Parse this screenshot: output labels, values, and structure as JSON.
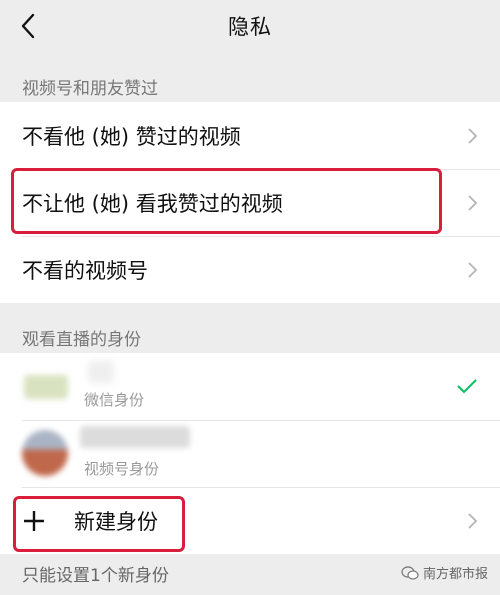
{
  "nav": {
    "title": "隐私",
    "back_icon": "chevron-left-icon"
  },
  "section1": {
    "label": "视频号和朋友赞过",
    "items": [
      {
        "label": "不看他 (她) 赞过的视频"
      },
      {
        "label": "不让他 (她) 看我赞过的视频",
        "highlighted": true
      },
      {
        "label": "不看的视频号"
      }
    ]
  },
  "section2": {
    "label": "观看直播的身份",
    "identities": [
      {
        "sublabel": "微信身份",
        "selected": true
      },
      {
        "sublabel": "视频号身份",
        "selected": false
      }
    ],
    "new_identity": {
      "label": "新建身份",
      "highlighted": true
    }
  },
  "footer": {
    "note": "只能设置1个新身份"
  },
  "watermark": {
    "text": "南方都市报",
    "icon": "wechat-icon"
  },
  "colors": {
    "highlight": "#d81e3a",
    "check": "#07c160",
    "background": "#ededed"
  }
}
